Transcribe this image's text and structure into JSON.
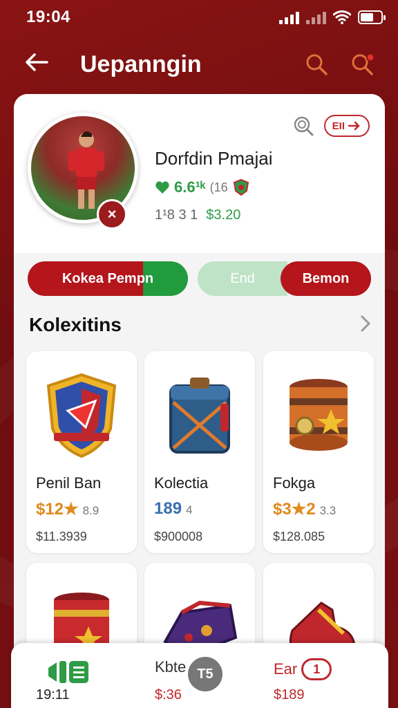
{
  "status_bar": {
    "time": "19:04"
  },
  "header": {
    "title": "Uepanngin"
  },
  "profile": {
    "name": "Dorfdin Pmajai",
    "rating": "6.6¹ᵏ",
    "rating_extra": "(16",
    "stat_a": "1¹8 3 1",
    "stat_b": "$3.20",
    "tag_label": "EII",
    "badge_glyph": "×"
  },
  "actions": {
    "left_label": "Kokea Pempn",
    "right_a_label": "End",
    "right_b_label": "Bemon"
  },
  "section": {
    "title": "Kolexitins"
  },
  "items": [
    {
      "name": "Penil Ban",
      "rating": "$12★",
      "rating_sub": "8.9",
      "price": "$11.3939",
      "rating_color": "#e08a1e",
      "icon": "shield-icon"
    },
    {
      "name": "Kolectia",
      "rating": "189",
      "rating_sub": "4",
      "price": "$900008",
      "rating_color": "#3a6fb0",
      "icon": "backpack-icon"
    },
    {
      "name": "Fokga",
      "rating": "$3★2",
      "rating_sub": "3.3",
      "price": "$128.085",
      "rating_color": "#e08a1e",
      "icon": "drum-icon"
    },
    {
      "name": "",
      "icon": "barrel-icon"
    },
    {
      "name": "",
      "icon": "bag-icon"
    },
    {
      "name": "",
      "icon": "boot-icon"
    }
  ],
  "bottom_bar": {
    "left_bottom": "19:11",
    "center_top": "Kbte",
    "center_bottom": "$:36",
    "fab_label": "T5",
    "right_top": "Ear",
    "right_icon_text": "1",
    "right_bottom": "$189"
  },
  "colors": {
    "brand": "#b4161c",
    "accent_green": "#2e9b47"
  }
}
